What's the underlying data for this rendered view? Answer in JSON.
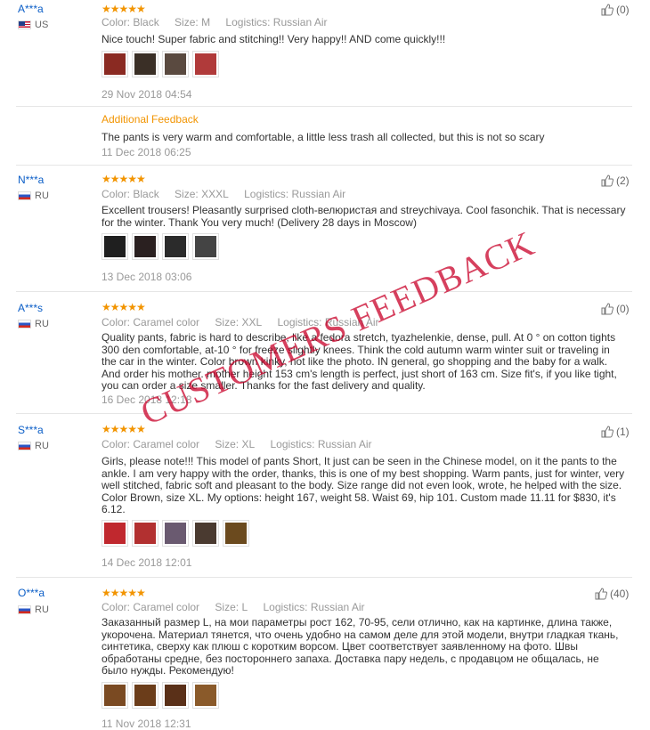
{
  "reviews": [
    {
      "user": "A***a",
      "country": "US",
      "flag": "us",
      "stars": "★★★★★",
      "color_label": "Color:",
      "color": "Black",
      "size_label": "Size:",
      "size": "M",
      "log_label": "Logistics:",
      "logistics": "Russian Air",
      "text": "Nice touch! Super fabric and stitching!! Very happy!! AND come quickly!!!",
      "date": "29 Nov 2018 04:54",
      "likes": "(0)",
      "images": [
        "#8a2a22",
        "#3a2f26",
        "#5a4a40",
        "#b03a3a"
      ],
      "additional": {
        "title": "Additional Feedback",
        "text": "The pants is very warm and comfortable, a little less trash all collected, but this is not so scary",
        "date": "11 Dec 2018 06:25"
      }
    },
    {
      "user": "N***a",
      "country": "RU",
      "flag": "ru",
      "stars": "★★★★★",
      "color_label": "Color:",
      "color": "Black",
      "size_label": "Size:",
      "size": "XXXL",
      "log_label": "Logistics:",
      "logistics": "Russian Air",
      "text": "Excellent trousers! Pleasantly surprised cloth-велюристая and streychivaya. Cool fasonchik. That is necessary for the winter. Thank You very much! (Delivery 28 days in Moscow)",
      "date": "13 Dec 2018 03:06",
      "likes": "(2)",
      "images": [
        "#1f1f1f",
        "#2a2020",
        "#2b2b2b",
        "#444"
      ]
    },
    {
      "user": "A***s",
      "country": "RU",
      "flag": "ru",
      "stars": "★★★★★",
      "color_label": "Color:",
      "color": "Caramel color",
      "size_label": "Size:",
      "size": "XXL",
      "log_label": "Logistics:",
      "logistics": "Russian Air",
      "text": "Quality pants, fabric is hard to describe, like a fedora stretch, tyazhelenkie, dense, pull. At 0 ° on cotton tights 300 den comfortable, at-10 ° for freeze slightly knees. Think the cold autumn warm winter suit or traveling in the car in the winter. Color brown kinky, not like the photo. IN general, go shopping and the baby for a walk. And order his mother. mother height 153 cm's length is perfect, just short of 163 cm. Size fit's, if you like tight, you can order a size smaller. Thanks for the fast delivery and quality.",
      "date": "16 Dec 2018 12:18",
      "likes": "(0)",
      "images": []
    },
    {
      "user": "S***a",
      "country": "RU",
      "flag": "ru",
      "stars": "★★★★★",
      "color_label": "Color:",
      "color": "Caramel color",
      "size_label": "Size:",
      "size": "XL",
      "log_label": "Logistics:",
      "logistics": "Russian Air",
      "text": "Girls, please note!!! This model of pants Short, It just can be seen in the Chinese model, on it the pants to the ankle. I am very happy with the order, thanks, this is one of my best shopping. Warm pants, just for winter, very well stitched, fabric soft and pleasant to the body. Size range did not even look, wrote, he helped with the size. Color Brown, size XL. My options: height 167, weight 58. Waist 69, hip 101. Custom made 11.11 for $830, it's 6.12.",
      "date": "14 Dec 2018 12:01",
      "likes": "(1)",
      "images": [
        "#c0282e",
        "#b23030",
        "#6a5a70",
        "#4a3a30",
        "#6b4a1e"
      ]
    },
    {
      "user": "O***a",
      "country": "RU",
      "flag": "ru",
      "stars": "★★★★★",
      "color_label": "Color:",
      "color": "Caramel color",
      "size_label": "Size:",
      "size": "L",
      "log_label": "Logistics:",
      "logistics": "Russian Air",
      "text": "Заказанный размер L, на мои параметры рост 162, 70-95, сели отлично, как на картинке, длина также, укорочена. Материал тянется, что очень удобно на самом деле для этой модели, внутри гладкая ткань, синтетика, сверху как плюш с коротким ворсом. Цвет соответствует заявленному на фото. Швы обработаны средне, без постороннего запаха. Доставка пару недель, с продавцом не общалась, не было нужды. Рекомендую!",
      "date": "11 Nov 2018 12:31",
      "likes": "(40)",
      "images": [
        "#7a4a22",
        "#6b3d1a",
        "#5a3018",
        "#8a5a2a"
      ]
    }
  ],
  "watermark": "CUSTOMERS FEEDBACK"
}
